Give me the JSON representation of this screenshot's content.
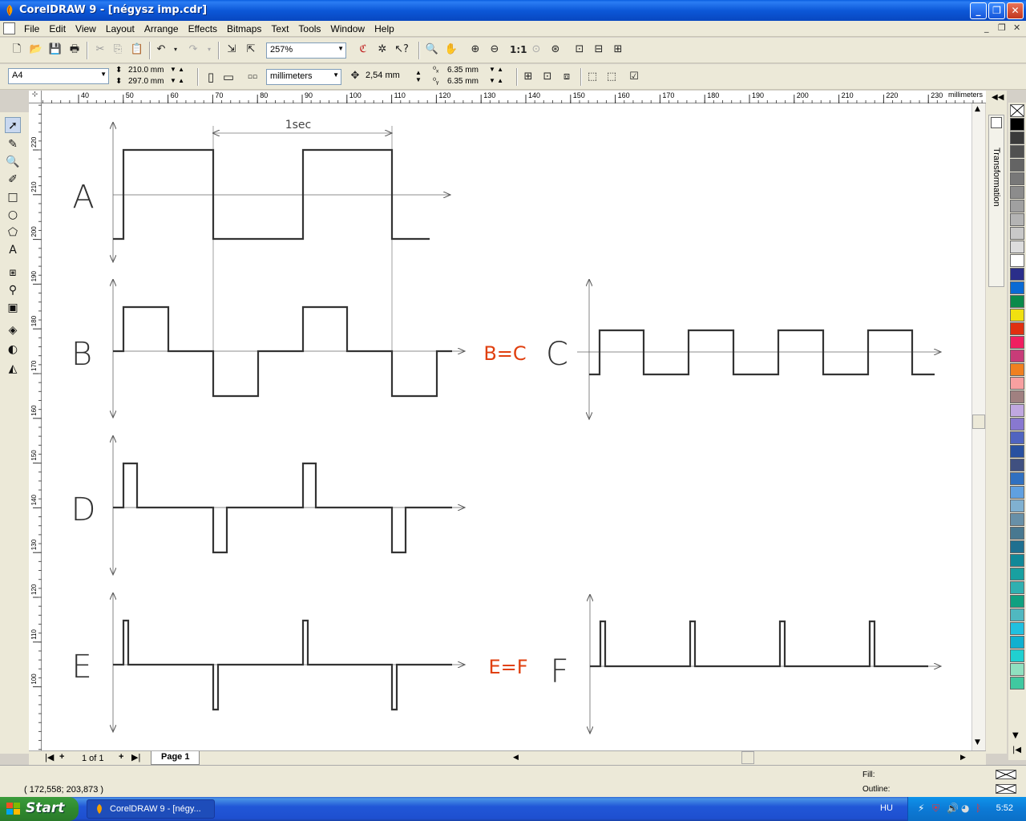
{
  "window": {
    "title": "CorelDRAW 9 - [négysz imp.cdr]"
  },
  "menu": [
    "File",
    "Edit",
    "View",
    "Layout",
    "Arrange",
    "Effects",
    "Bitmaps",
    "Text",
    "Tools",
    "Window",
    "Help"
  ],
  "toolbar": {
    "zoom": "257%"
  },
  "property_bar": {
    "page_size": "A4",
    "width": "210.0 mm",
    "height": "297.0 mm",
    "units": "millimeters",
    "nudge": "2,54 mm",
    "dup_x": "6.35 mm",
    "dup_y": "6.35 mm"
  },
  "rulers": {
    "unit_label": "millimeters",
    "h_ticks": [
      "40",
      "50",
      "60",
      "70",
      "80",
      "90",
      "100",
      "110",
      "120",
      "130",
      "140",
      "150",
      "160",
      "170",
      "180",
      "190",
      "200",
      "210",
      "220",
      "230"
    ],
    "v_ticks": [
      "220",
      "210",
      "200",
      "190",
      "180",
      "170",
      "160",
      "150",
      "140",
      "130",
      "120",
      "110",
      "100"
    ]
  },
  "drawing": {
    "labels": {
      "A": "A",
      "B": "B",
      "C": "C",
      "D": "D",
      "E": "E",
      "F": "F"
    },
    "period_label": "1sec",
    "eq_bc": "B=C",
    "eq_ef": "E=F",
    "accent_color": "#e04010"
  },
  "docker": {
    "tab": "Transformation"
  },
  "page_nav": {
    "count": "1 of 1",
    "page_tab": "Page 1"
  },
  "status": {
    "coords": "( 172,558; 203,873 )",
    "fill": "Fill:",
    "outline": "Outline:"
  },
  "taskbar": {
    "start": "Start",
    "task": "CorelDRAW 9 - [négy...",
    "lang": "HU",
    "clock": "5:52"
  },
  "palette": [
    "#ffffff",
    "#000000",
    "#3a3a3a",
    "#505050",
    "#646464",
    "#787878",
    "#8c8c8c",
    "#a0a0a0",
    "#b4b4b4",
    "#c8c8c8",
    "#dcdcdc",
    "#ffffff",
    "#2a2e8a",
    "#0a6ad4",
    "#0a8a4a",
    "#f0e010",
    "#e03010",
    "#f02060",
    "#c83c78",
    "#f08020",
    "#f8a0a0",
    "#a08080",
    "#c0a8e0",
    "#8878d0",
    "#5064c0",
    "#2850a0",
    "#405080",
    "#3070c0",
    "#60a0e0",
    "#80b0d0",
    "#6890a8",
    "#487890",
    "#207090",
    "#108898",
    "#18a0a0",
    "#30b0b0",
    "#10a080",
    "#50b8c0",
    "#20c0e0",
    "#10b0d0",
    "#20d0d0",
    "#90e0c0",
    "#40c8a0"
  ]
}
